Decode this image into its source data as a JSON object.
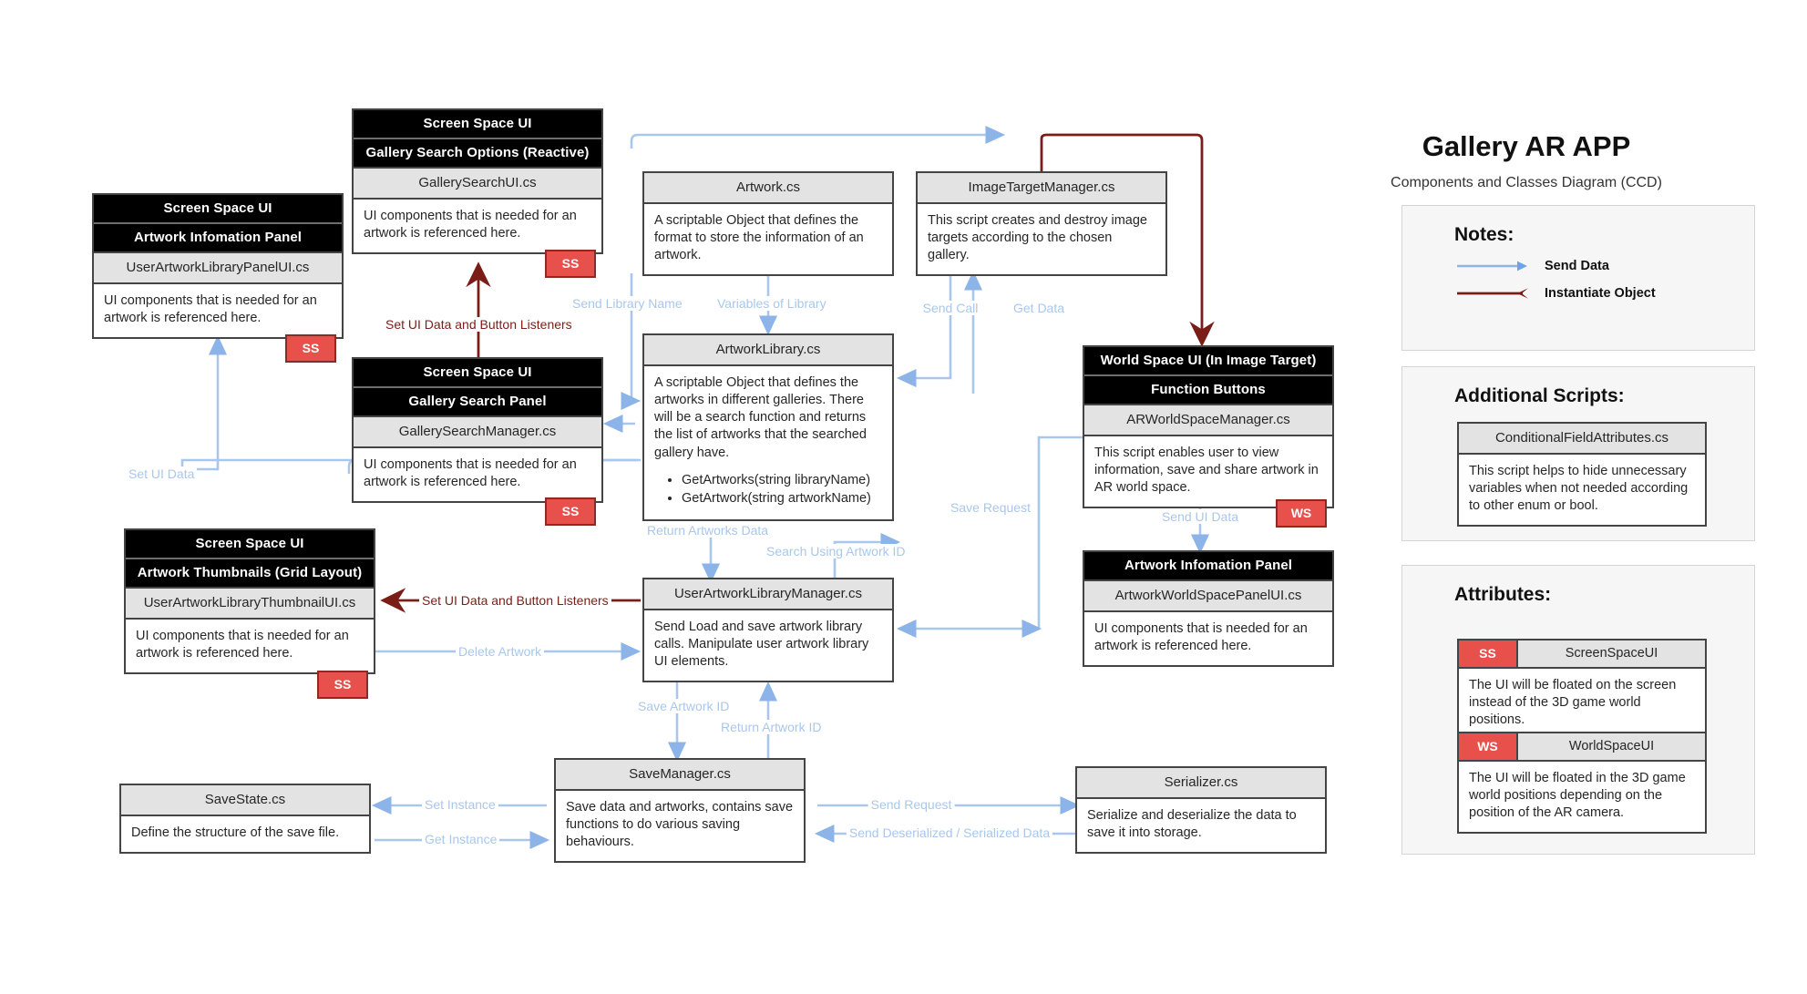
{
  "header": {
    "title": "Gallery AR APP",
    "subtitle": "Components and Classes Diagram (CCD)"
  },
  "notes_panel": {
    "title": "Notes:",
    "legend": [
      {
        "label": "Send Data",
        "color": "#8cb4e8",
        "arrow": "right"
      },
      {
        "label": "Instantiate Object",
        "color": "#7b1d17",
        "arrow": "left"
      }
    ]
  },
  "additional_scripts_panel": {
    "title": "Additional Scripts:",
    "cards": [
      {
        "name": "ConditionalFieldAttributes.cs",
        "description": "This script helps to hide unnecessary variables when not needed according to other enum or bool."
      }
    ]
  },
  "attributes_panel": {
    "title": "Attributes:",
    "items": [
      {
        "tag": "SS",
        "name": "ScreenSpaceUI",
        "description": "The UI will be floated on the screen instead of the 3D game world positions."
      },
      {
        "tag": "WS",
        "name": "WorldSpaceUI",
        "description": "The UI will be floated in the 3D game world positions depending on the position of the AR camera."
      }
    ]
  },
  "nodes": {
    "artwork_library_panel": {
      "headers": [
        "Screen Space UI",
        "Artwork Infomation Panel"
      ],
      "script": "UserArtworkLibraryPanelUI.cs",
      "description": "UI components that is needed for an artwork is referenced here.",
      "chip": "SS"
    },
    "gallery_search_ui": {
      "headers": [
        "Screen Space UI",
        "Gallery Search Options (Reactive)"
      ],
      "script": "GallerySearchUI.cs",
      "description": "UI components that is needed for an artwork is referenced here.",
      "chip": "SS"
    },
    "gallery_search_manager": {
      "headers": [
        "Screen Space UI",
        "Gallery Search Panel"
      ],
      "script": "GallerySearchManager.cs",
      "description": "UI components that is needed for an artwork is referenced here.",
      "chip": "SS"
    },
    "artwork_thumbnail": {
      "headers": [
        "Screen Space UI",
        "Artwork Thumbnails (Grid Layout)"
      ],
      "script": "UserArtworkLibraryThumbnailUI.cs",
      "description": "UI components that is needed for an artwork is referenced here.",
      "chip": "SS"
    },
    "artwork": {
      "script": "Artwork.cs",
      "description": "A scriptable Object that defines the format to store the information of an artwork."
    },
    "artwork_library": {
      "script": "ArtworkLibrary.cs",
      "description": "A scriptable Object that defines the artworks in different galleries. There will be a search function and returns the list of artworks that the searched gallery have.",
      "methods": [
        "GetArtworks(string libraryName)",
        "GetArtwork(string artworkName)"
      ]
    },
    "image_target_manager": {
      "script": "ImageTargetManager.cs",
      "description": "This script creates and destroy image targets according to the chosen gallery."
    },
    "ar_world_space_manager": {
      "headers": [
        "World Space UI (In Image Target)",
        "Function Buttons"
      ],
      "script": "ARWorldSpaceManager.cs",
      "description": "This script enables user to view information, save and share artwork in AR world space.",
      "chip": "WS"
    },
    "artwork_world_space_panel": {
      "headers": [
        "Artwork Infomation Panel"
      ],
      "script": "ArtworkWorldSpacePanelUI.cs",
      "description": "UI components that is needed for an artwork is referenced here."
    },
    "user_artwork_library_manager": {
      "script": "UserArtworkLibraryManager.cs",
      "description": "Send Load and save artwork library calls. Manipulate user artwork library UI elements."
    },
    "save_state": {
      "script": "SaveState.cs",
      "description": "Define the structure of the save file."
    },
    "save_manager": {
      "script": "SaveManager.cs",
      "description": "Save data and artworks, contains save functions to do various saving behaviours."
    },
    "serializer": {
      "script": "Serializer.cs",
      "description": "Serialize and deserialize the data to save it into storage."
    }
  },
  "edge_labels": {
    "set_ui_data_listeners_top": "Set UI Data and Button Listeners",
    "set_ui_data_listeners_bottom": "Set UI Data and Button Listeners",
    "send_library_name": "Send Library Name",
    "variables_of_library": "Variables of Library",
    "send_call": "Send Call",
    "get_data": "Get Data",
    "set_ui_data_left": "Set UI Data",
    "return_artworks_data": "Return Artworks Data",
    "search_using_artwork_id": "Search Using Artwork ID",
    "delete_artwork": "Delete Artwork",
    "save_request": "Save Request",
    "send_ui_data": "Send UI Data",
    "save_artwork_id": "Save Artwork ID",
    "return_artwork_id": "Return Artwork ID",
    "set_instance": "Set Instance",
    "get_instance": "Get Instance",
    "send_request": "Send Request",
    "send_deserialized_data": "Send Deserialized / Serialized Data"
  }
}
